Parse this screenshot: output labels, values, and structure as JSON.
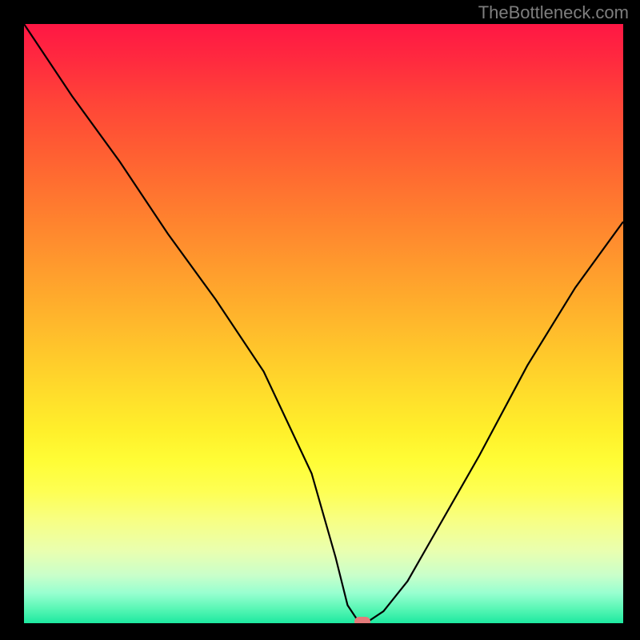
{
  "watermark": "TheBottleneck.com",
  "chart_data": {
    "type": "line",
    "title": "",
    "xlabel": "",
    "ylabel": "",
    "xlim": [
      0,
      100
    ],
    "ylim": [
      0,
      100
    ],
    "grid": false,
    "series": [
      {
        "name": "curve",
        "x": [
          0,
          8,
          16,
          24,
          32,
          40,
          48,
          52,
          54,
          56,
          57,
          60,
          64,
          68,
          76,
          84,
          92,
          100
        ],
        "values": [
          100,
          88,
          77,
          65,
          54,
          42,
          25,
          11,
          3,
          0,
          0,
          2,
          7,
          14,
          28,
          43,
          56,
          67
        ]
      }
    ],
    "marker": {
      "x": 56.5,
      "y": 0
    },
    "background_gradient": {
      "type": "vertical",
      "stops": [
        {
          "pos": 0,
          "color": "#ff1744"
        },
        {
          "pos": 50,
          "color": "#ffb22c"
        },
        {
          "pos": 75,
          "color": "#fffd36"
        },
        {
          "pos": 100,
          "color": "#1de9a0"
        }
      ]
    }
  }
}
